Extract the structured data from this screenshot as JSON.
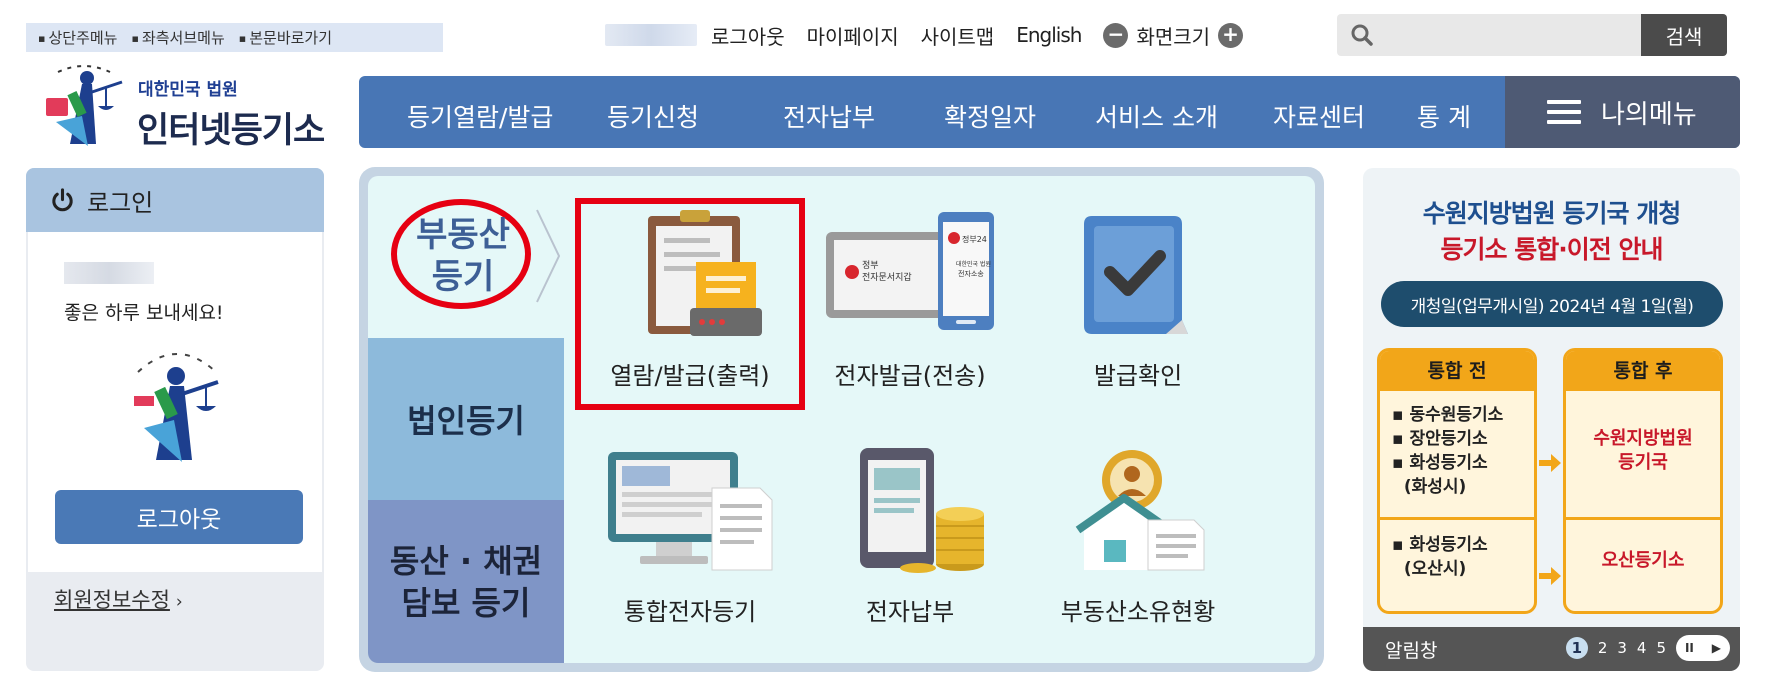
{
  "skip_links": [
    "상단주메뉴",
    "좌측서브메뉴",
    "본문바로가기"
  ],
  "util": {
    "logout": "로그아웃",
    "mypage": "마이페이지",
    "sitemap": "사이트맵",
    "english": "English",
    "zoom_label": "화면크기",
    "zoom_out": "−",
    "zoom_in": "+"
  },
  "search": {
    "placeholder": "",
    "button": "검색"
  },
  "logo": {
    "small": "대한민국 법원",
    "big": "인터넷등기소"
  },
  "gnb": {
    "items": [
      "등기열람/발급",
      "등기신청",
      "전자납부",
      "확정일자",
      "서비스 소개",
      "자료센터",
      "통 계"
    ],
    "my_menu": "나의메뉴"
  },
  "login": {
    "title": "로그인",
    "greeting": "좋은 하루 보내세요!",
    "logout_button": "로그아웃",
    "edit_info": "회원정보수정",
    "edit_chevron": "›"
  },
  "categories": {
    "realestate": [
      "부동산",
      "등기"
    ],
    "corporate": "법인등기",
    "movable": [
      "동산 · 채권",
      "담보 등기"
    ]
  },
  "services": [
    {
      "name": "열람/발급(출력)",
      "icon": "clipboard-printer-icon"
    },
    {
      "name": "전자발급(전송)",
      "icon": "tablet-phone-icon"
    },
    {
      "name": "발급확인",
      "icon": "checkmark-icon"
    },
    {
      "name": "통합전자등기",
      "icon": "monitor-document-icon"
    },
    {
      "name": "전자납부",
      "icon": "phone-coins-icon"
    },
    {
      "name": "부동산소유현황",
      "icon": "house-person-icon"
    }
  ],
  "tablet_text": {
    "left_small": "정부",
    "left_big": "전자문서지갑",
    "phone_top": "정부24",
    "phone_sub1": "대한민국 법원",
    "phone_sub2": "전자소송"
  },
  "banner": {
    "title1": "수원지방법원 등기국 개청",
    "title2": "등기소 통합·이전 안내",
    "date": "개청일(업무개시일) 2024년 4월 1일(월)",
    "before_title": "통합 전",
    "after_title": "통합 후",
    "before_list1": [
      "▪ 동수원등기소",
      "▪ 장안등기소",
      "▪ 화성등기소",
      "  (화성시)"
    ],
    "after_dest1": [
      "수원지방법원",
      "등기국"
    ],
    "before_list2": [
      "▪ 화성등기소",
      "  (오산시)"
    ],
    "after_dest2": "오산등기소",
    "footer_label": "알림창",
    "pages": [
      "1",
      "2",
      "3",
      "4",
      "5"
    ],
    "pause": "II",
    "play": "▶"
  }
}
